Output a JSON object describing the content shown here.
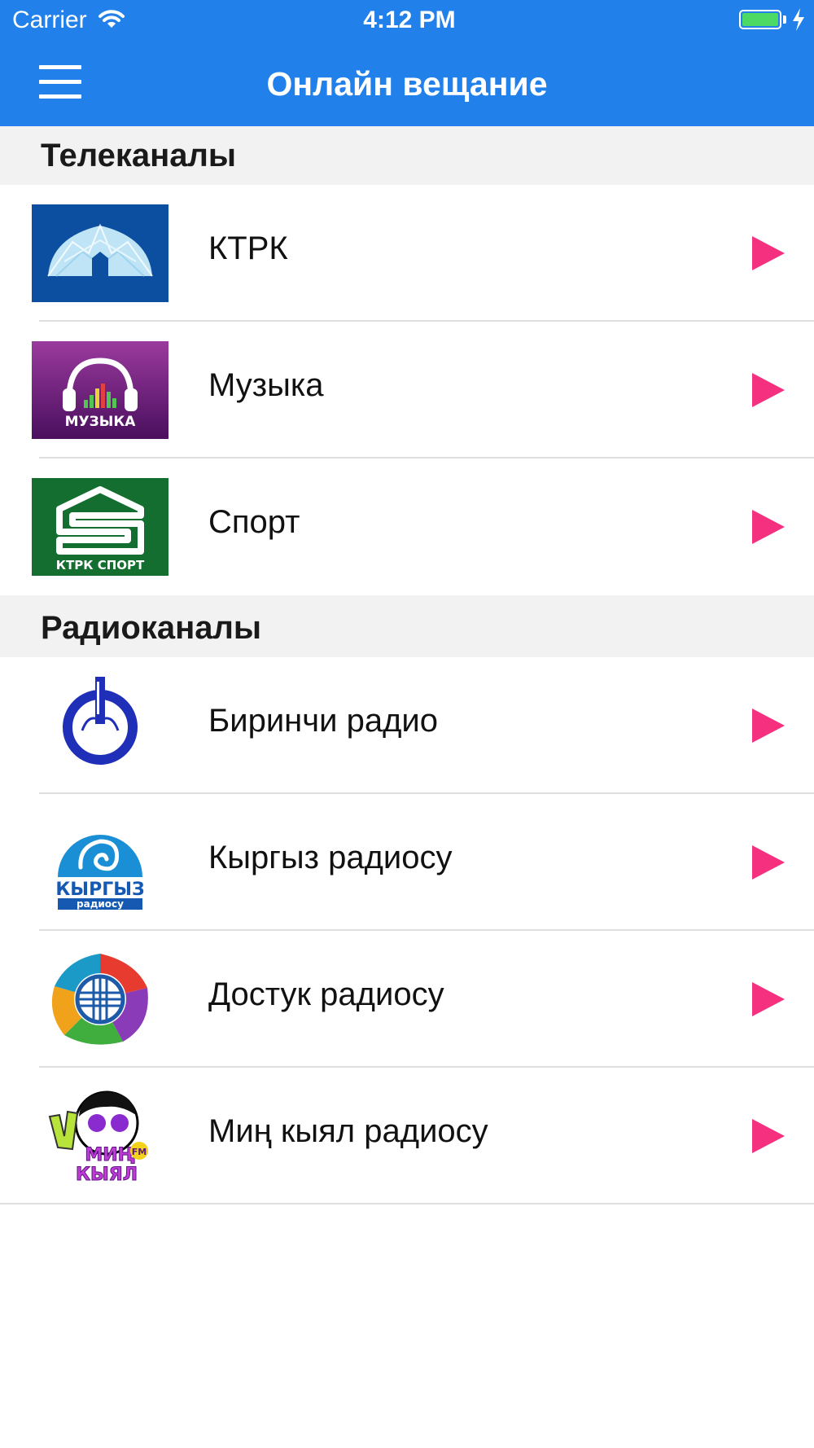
{
  "status_bar": {
    "carrier": "Carrier",
    "time": "4:12 PM"
  },
  "nav": {
    "title": "Онлайн вещание",
    "menu_icon": "hamburger-menu-icon"
  },
  "colors": {
    "nav": "#2180e9",
    "play": "#f5317f",
    "section_bg": "#f2f2f2"
  },
  "sections": [
    {
      "title": "Телеканалы",
      "items": [
        {
          "name": "КТРК",
          "logo": "ktrk-yurt-logo"
        },
        {
          "name": "Музыка",
          "logo": "muzyka-headphones-logo",
          "logo_text": "МУЗЫКА"
        },
        {
          "name": "Спорт",
          "logo": "ktrk-sport-logo",
          "logo_text": "КТРК СПОРТ"
        }
      ]
    },
    {
      "title": "Радиоканалы",
      "items": [
        {
          "name": "Биринчи радио",
          "logo": "birinchi-radio-logo"
        },
        {
          "name": "Кыргыз радиосу",
          "logo": "kyrgyz-radiosu-logo",
          "logo_text": "КЫРГЫЗ",
          "logo_subtext": "радиосу"
        },
        {
          "name": "Достук радиосу",
          "logo": "dostuk-radiosu-logo"
        },
        {
          "name": "Миң кыял радиосу",
          "logo": "min-kyyal-radiosu-logo",
          "logo_text": "МИҢ",
          "logo_subtext": "КЫЯЛ",
          "logo_badge": "FM"
        }
      ]
    }
  ]
}
